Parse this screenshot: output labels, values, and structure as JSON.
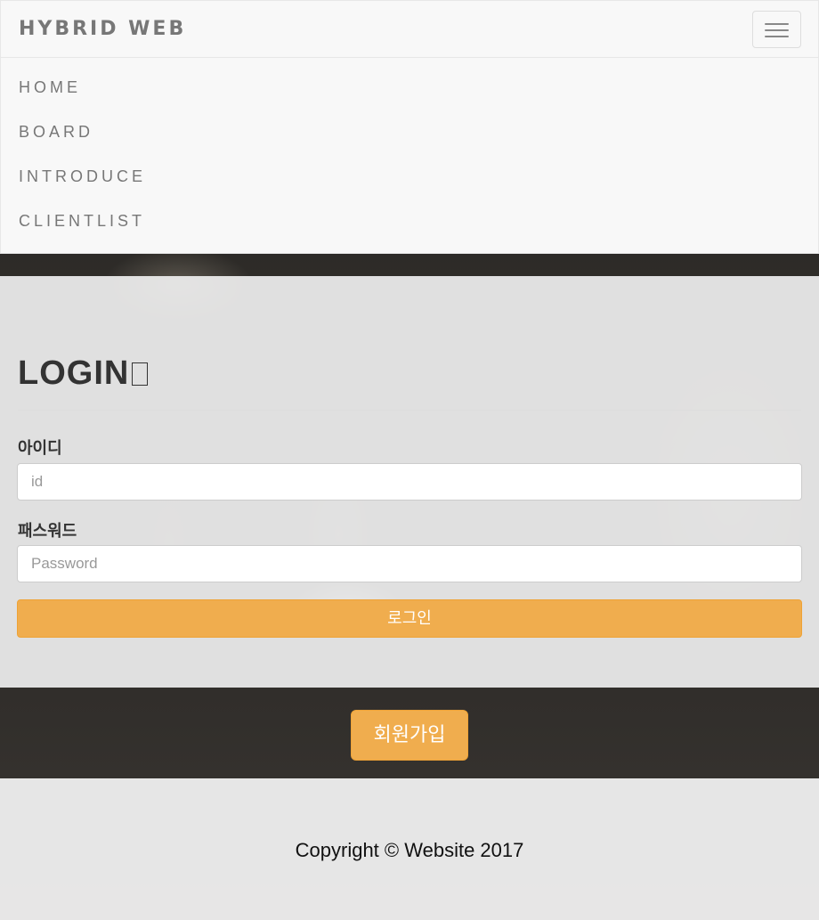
{
  "navbar": {
    "brand": "HYBRID WEB",
    "toggle_icon": "hamburger-menu-icon",
    "items": [
      {
        "label": "HOME"
      },
      {
        "label": "BOARD"
      },
      {
        "label": "INTRODUCE"
      },
      {
        "label": "CLIENTLIST"
      }
    ]
  },
  "login": {
    "title": "LOGIN",
    "id_label": "아이디",
    "id_placeholder": "id",
    "password_label": "패스워드",
    "password_placeholder": "Password",
    "submit_label": "로그인"
  },
  "signup": {
    "label": "회원가입"
  },
  "footer": {
    "copyright": "Copyright © Website 2017"
  },
  "colors": {
    "accent": "#f0ad4e",
    "navbar_bg": "#f8f8f8",
    "nav_text": "#777777"
  }
}
